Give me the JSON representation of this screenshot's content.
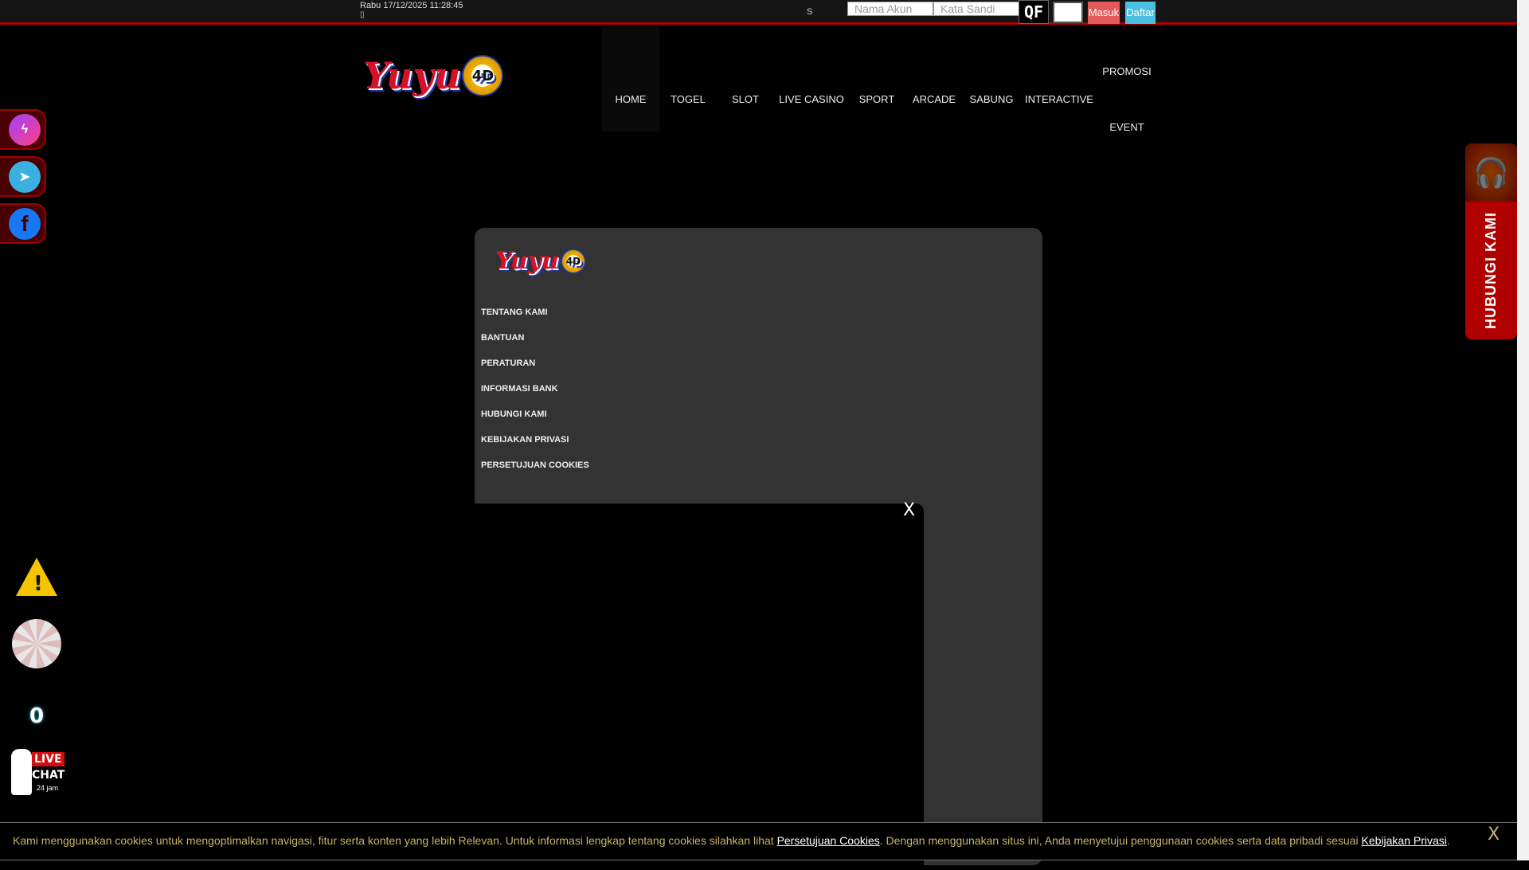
{
  "topbar": {
    "datetime": "Rabu 17/12/2025 11:28:45",
    "glyph": "▯",
    "s_label": "S",
    "username_placeholder": "Nama Akun",
    "password_placeholder": "Kata Sandi",
    "captcha_text": "QF",
    "login_label": "Masuk",
    "register_label": "Daftar"
  },
  "brand": {
    "logo_text": "Yuyu",
    "logo_ball": "4D"
  },
  "nav": [
    "HOME",
    "TOGEL",
    "SLOT",
    "LIVE CASINO",
    "SPORT",
    "ARCADE",
    "SABUNG",
    "INTERACTIVE",
    "PROMOSI",
    "EVENT"
  ],
  "panel": {
    "menu": [
      "TENTANG KAMI",
      "BANTUAN",
      "PERATURAN",
      "INFORMASI BANK",
      "HUBUNGI KAMI",
      "KEBIJAKAN PRIVASI",
      "PERSETUJUAN COOKIES"
    ],
    "close": "X"
  },
  "cookie": {
    "text1": "Kami menggunakan cookies untuk mengoptimalkan navigasi, fitur serta konten yang lebih Relevan. Untuk informasi lengkap tentang cookies silahkan lihat ",
    "link1": "Persetujuan Cookies",
    "text2": ". Dengan menggunakan situs ini, Anda menyetujui penggunaan cookies serta data pribadi sesuai ",
    "link2": "Kebijakan Privasi",
    "text3": ".",
    "close": "X"
  },
  "side": {
    "contact_label": "HUBUNGI KAMI",
    "counter": "0",
    "livechat_live": "LIVE",
    "livechat_chat": "CHAT",
    "livechat_hours": "24 jam"
  },
  "colors": {
    "accent_red": "#b30000",
    "login": "#e25a5a",
    "register": "#4bbfe0",
    "cookie_text": "#c9b46a"
  }
}
